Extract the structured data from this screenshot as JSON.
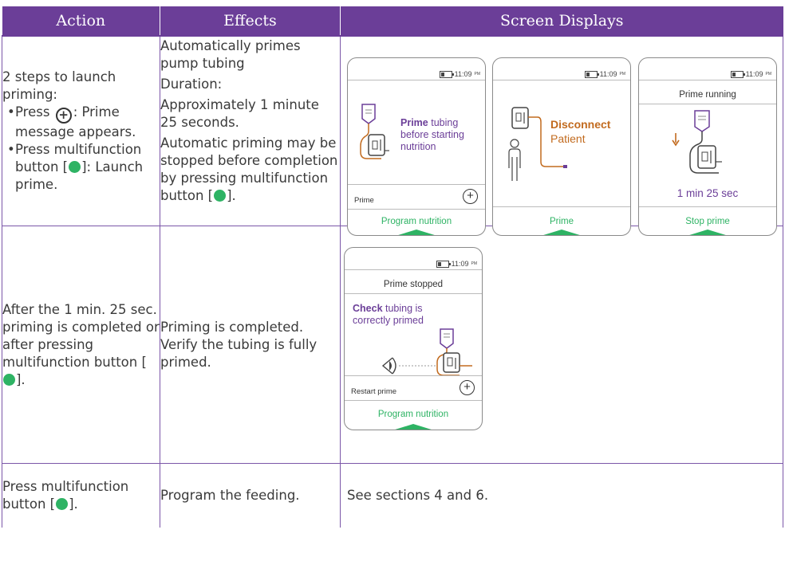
{
  "headers": {
    "action": "Action",
    "effects": "Effects",
    "screens": "Screen Displays"
  },
  "row1": {
    "action": {
      "intro": "2 steps to launch priming:",
      "bullet1_press": "Press",
      "bullet1_rest": ": Prime message appears.",
      "bullet2_pre": "Press multifunction button [",
      "bullet2_post": "]: Launch prime."
    },
    "effects": {
      "line1": "Automatically primes pump tubing",
      "line2": "Duration:",
      "line3": "Approximately 1 minute 25 seconds.",
      "line4_pre": "Automatic priming may be stopped before completion by pressing multifunction button [",
      "line4_post": "]."
    }
  },
  "screen1": {
    "time": "11:09",
    "time_suffix": "PM",
    "msg_bold": "Prime",
    "msg_rest1": " tubing",
    "msg_rest2": "before starting",
    "msg_rest3": "nutrition",
    "option": "Prime",
    "footer": "Program nutrition"
  },
  "screen2": {
    "time": "11:09",
    "time_suffix": "PM",
    "msg_bold": "Disconnect",
    "msg_rest": "Patient",
    "footer": "Prime"
  },
  "screen3": {
    "time": "11:09",
    "time_suffix": "PM",
    "title": "Prime running",
    "duration": "1 min 25 sec",
    "footer": "Stop prime"
  },
  "row2": {
    "action_pre": "After the 1 min. 25 sec. priming is completed or after pressing multifunction button [",
    "action_post": "].",
    "effects": "Priming is completed. Verify the tubing is fully primed."
  },
  "screen4": {
    "time": "11:09",
    "time_suffix": "PM",
    "title": "Prime stopped",
    "msg_bold": "Check",
    "msg_rest1": " tubing is",
    "msg_rest2": "correctly primed",
    "option": "Restart prime",
    "footer": "Program nutrition"
  },
  "row3": {
    "action_pre": "Press multifunction button [",
    "action_post": "].",
    "effects": "Program the feeding.",
    "screens": "See sections 4 and 6."
  },
  "colors": {
    "header_bg": "#6b3e98",
    "accent_green": "#2eb364",
    "orange": "#c26b1f"
  }
}
